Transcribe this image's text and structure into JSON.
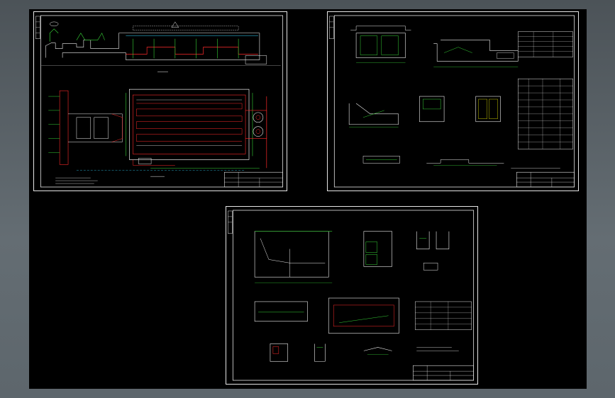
{
  "app": {
    "canvas_background": "#000000",
    "workspace_color": "#5a6268"
  },
  "colors": {
    "frame": "#e6e6e6",
    "green": "#37d337",
    "red": "#ff2a2a",
    "yellow": "#f2f200",
    "cyan": "#31d6ff",
    "white": "#f0f0f0"
  },
  "sheets": [
    {
      "id": "sheet-1"
    },
    {
      "id": "sheet-2"
    },
    {
      "id": "sheet-3"
    }
  ]
}
